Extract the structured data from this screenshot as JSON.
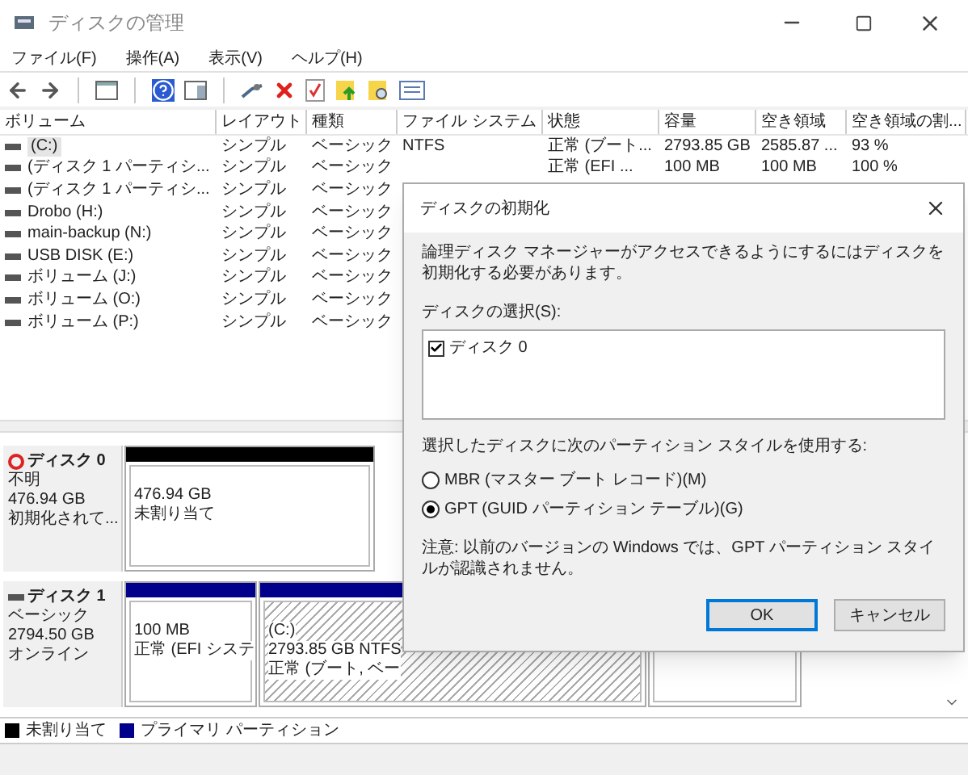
{
  "window": {
    "title": "ディスクの管理"
  },
  "menu": [
    "ファイル(F)",
    "操作(A)",
    "表示(V)",
    "ヘルプ(H)"
  ],
  "toolbar": [
    {
      "kind": "back"
    },
    {
      "kind": "forward"
    },
    {
      "kind": "sep"
    },
    {
      "kind": "console"
    },
    {
      "kind": "sep"
    },
    {
      "kind": "help"
    },
    {
      "kind": "panel"
    },
    {
      "kind": "sep"
    },
    {
      "kind": "connect"
    },
    {
      "kind": "delete"
    },
    {
      "kind": "check"
    },
    {
      "kind": "folder-up"
    },
    {
      "kind": "folder-search"
    },
    {
      "kind": "list"
    }
  ],
  "table": {
    "columns": [
      "ボリューム",
      "レイアウト",
      "種類",
      "ファイル システム",
      "状態",
      "容量",
      "空き領域",
      "空き領域の割..."
    ],
    "rows": [
      {
        "cells": [
          "(C:)",
          "シンプル",
          "ベーシック",
          "NTFS",
          "正常 (ブート...",
          "2793.85 GB",
          "2585.87 ...",
          "93 %"
        ],
        "selected": true
      },
      {
        "cells": [
          "(ディスク 1 パーティシ...",
          "シンプル",
          "ベーシック",
          "",
          "正常 (EFI ...",
          "100 MB",
          "100 MB",
          "100 %"
        ],
        "selected": false
      },
      {
        "cells": [
          "(ディスク 1 パーティシ...",
          "シンプル",
          "ベーシック"
        ],
        "selected": false
      },
      {
        "cells": [
          "Drobo (H:)",
          "シンプル",
          "ベーシック"
        ],
        "selected": false
      },
      {
        "cells": [
          "main-backup (N:)",
          "シンプル",
          "ベーシック"
        ],
        "selected": false
      },
      {
        "cells": [
          "USB DISK (E:)",
          "シンプル",
          "ベーシック"
        ],
        "selected": false
      },
      {
        "cells": [
          "ボリューム (J:)",
          "シンプル",
          "ベーシック"
        ],
        "selected": false
      },
      {
        "cells": [
          "ボリューム (O:)",
          "シンプル",
          "ベーシック"
        ],
        "selected": false
      },
      {
        "cells": [
          "ボリューム (P:)",
          "シンプル",
          "ベーシック"
        ],
        "selected": false
      }
    ]
  },
  "disks": [
    {
      "name": "ディスク 0",
      "alert": true,
      "lines": [
        "不明",
        "476.94 GB",
        "初期化されて..."
      ],
      "partitions": [
        {
          "kind": "unallocated",
          "lines": [
            "476.94 GB",
            "未割り当て"
          ]
        }
      ]
    },
    {
      "name": "ディスク 1",
      "alert": false,
      "lines": [
        "ベーシック",
        "2794.50 GB",
        "オンライン"
      ],
      "partitions": [
        {
          "kind": "primary",
          "lines": [
            "100 MB",
            "正常 (EFI システ"
          ]
        },
        {
          "kind": "primary-hatched",
          "lines": [
            "(C:)",
            "2793.85 GB NTFS",
            "正常 (ブート, ベー"
          ]
        },
        {
          "kind": "primary"
        }
      ]
    }
  ],
  "legend": [
    {
      "label": "未割り当て",
      "color": "#000000"
    },
    {
      "label": "プライマリ パーティション",
      "color": "#00008b"
    }
  ],
  "dialog": {
    "title": "ディスクの初期化",
    "message": "論理ディスク マネージャーがアクセスできるようにするにはディスクを初期化する必要があります。",
    "select_label": "ディスクの選択(S):",
    "disks": [
      {
        "label": "ディスク 0",
        "checked": true
      }
    ],
    "style_label": "選択したディスクに次のパーティション スタイルを使用する:",
    "options": [
      {
        "label": "MBR (マスター ブート レコード)(M)",
        "selected": false
      },
      {
        "label": "GPT (GUID パーティション テーブル)(G)",
        "selected": true
      }
    ],
    "note": "注意: 以前のバージョンの Windows では、GPT パーティション スタイルが認識されません。",
    "buttons": [
      {
        "label": "OK",
        "default": true
      },
      {
        "label": "キャンセル",
        "default": false
      }
    ]
  }
}
